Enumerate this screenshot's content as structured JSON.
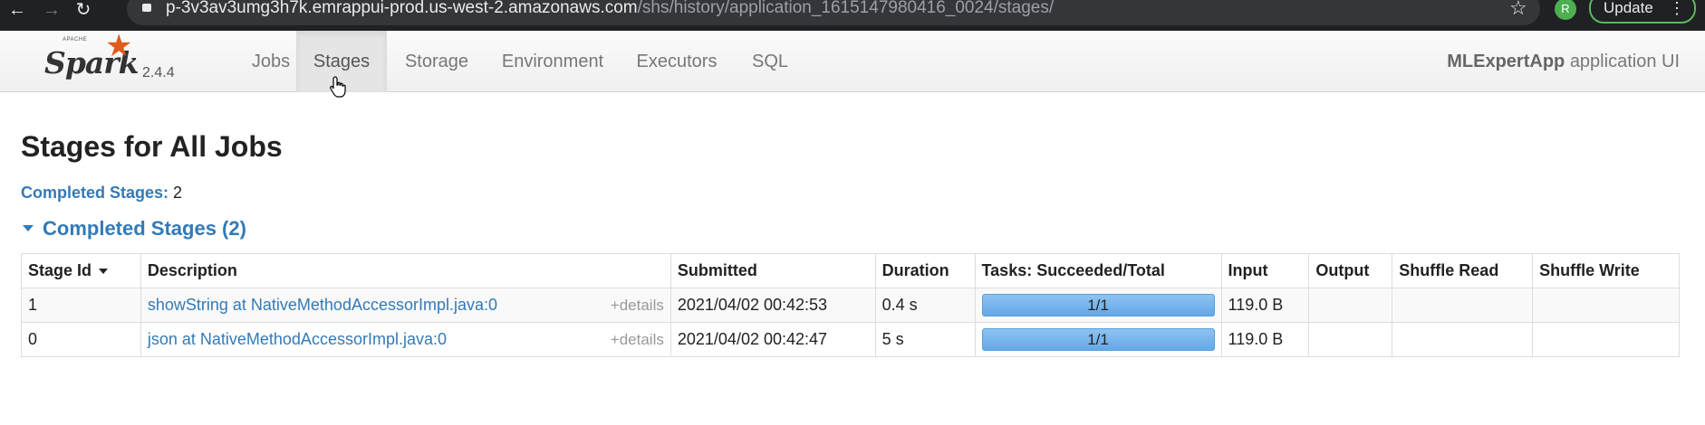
{
  "browser": {
    "url_host": "p-3v3av3umg3h7k.emrappui-prod.us-west-2.amazonaws.com",
    "url_path": "/shs/history/application_1615147980416_0024/stages/",
    "profile_initial": "R",
    "update_label": "Update"
  },
  "navbar": {
    "logo_apache": "APACHE",
    "logo_text": "Spark",
    "version": "2.4.4",
    "tabs": [
      {
        "label": "Jobs"
      },
      {
        "label": "Stages"
      },
      {
        "label": "Storage"
      },
      {
        "label": "Environment"
      },
      {
        "label": "Executors"
      },
      {
        "label": "SQL"
      }
    ],
    "app_name": "MLExpertApp",
    "app_suffix": "application UI"
  },
  "page": {
    "title": "Stages for All Jobs",
    "summary_label": "Completed Stages:",
    "summary_value": "2",
    "section_title": "Completed Stages (2)"
  },
  "table": {
    "headers": [
      "Stage Id",
      "Description",
      "Submitted",
      "Duration",
      "Tasks: Succeeded/Total",
      "Input",
      "Output",
      "Shuffle Read",
      "Shuffle Write"
    ],
    "details_label": "+details",
    "rows": [
      {
        "stage_id": "1",
        "description": "showString at NativeMethodAccessorImpl.java:0",
        "submitted": "2021/04/02 00:42:53",
        "duration": "0.4 s",
        "tasks": "1/1",
        "tasks_fraction": 1.0,
        "input": "119.0 B",
        "output": "",
        "shuffle_read": "",
        "shuffle_write": ""
      },
      {
        "stage_id": "0",
        "description": "json at NativeMethodAccessorImpl.java:0",
        "submitted": "2021/04/02 00:42:47",
        "duration": "5 s",
        "tasks": "1/1",
        "tasks_fraction": 1.0,
        "input": "119.0 B",
        "output": "",
        "shuffle_read": "",
        "shuffle_write": ""
      }
    ]
  },
  "colors": {
    "link": "#337ab7",
    "spark_orange": "#e25a1c",
    "progress_fill": "#63a8e8"
  }
}
